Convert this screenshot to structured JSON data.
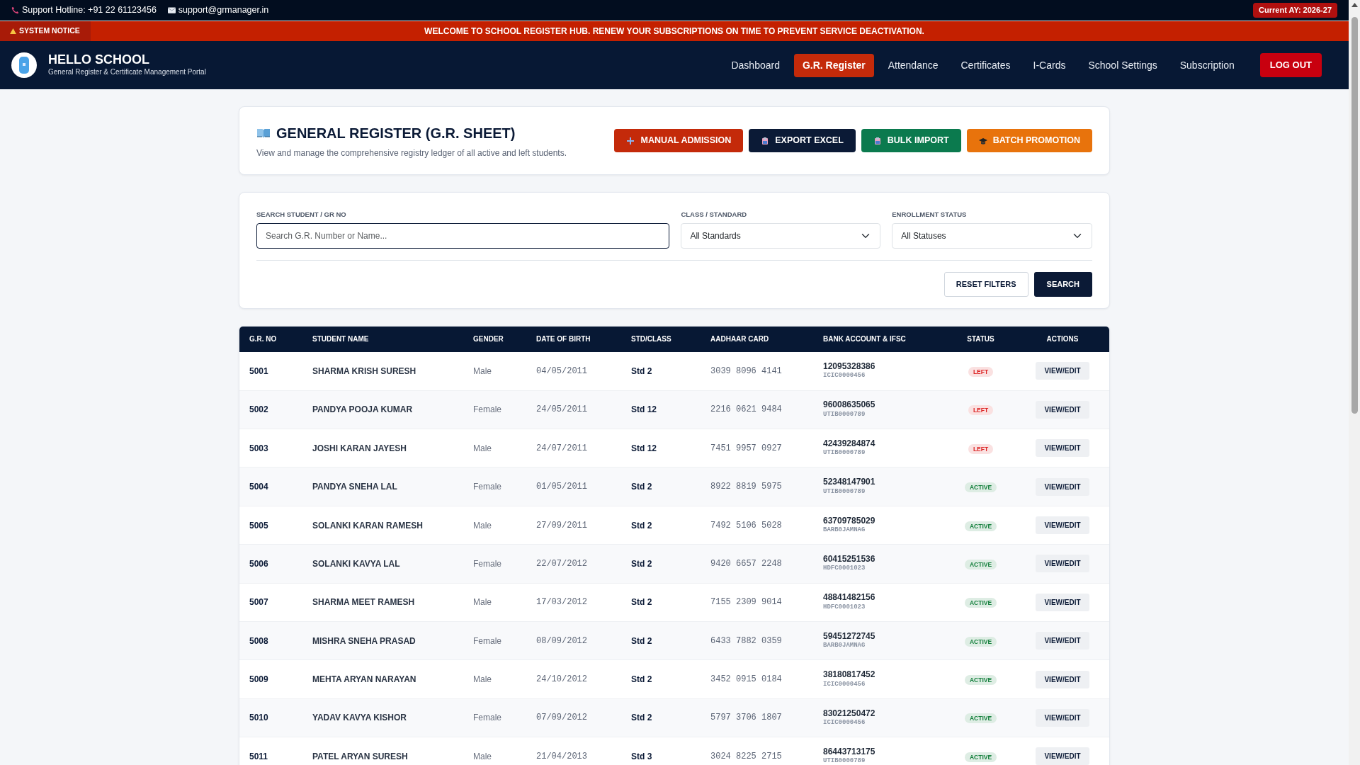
{
  "top_bar": {
    "hotline": "Support Hotline: +91 22 61123456",
    "email": "support@grmanager.in",
    "academic_year": "Current AY: 2026-27"
  },
  "notice": {
    "label": "SYSTEM NOTICE",
    "message": "WELCOME TO SCHOOL REGISTER HUB. RENEW YOUR SUBSCRIPTIONS ON TIME TO PREVENT SERVICE DEACTIVATION."
  },
  "header": {
    "title": "HELLO SCHOOL",
    "subtitle": "General Register & Certificate Management Portal",
    "nav": [
      {
        "label": "Dashboard",
        "selected": false
      },
      {
        "label": "G.R. Register",
        "selected": true
      },
      {
        "label": "Attendance",
        "selected": false
      },
      {
        "label": "Certificates",
        "selected": false
      },
      {
        "label": "I-Cards",
        "selected": false
      },
      {
        "label": "School Settings",
        "selected": false
      },
      {
        "label": "Subscription",
        "selected": false
      }
    ],
    "logout": "LOG OUT"
  },
  "page": {
    "title": "GENERAL REGISTER (G.R. SHEET)",
    "subtitle": "View and manage the comprehensive registry ledger of all active and left students.",
    "actions": [
      {
        "label": "MANUAL ADMISSION",
        "kind": "plus",
        "color": "#c42a0a"
      },
      {
        "label": "EXPORT EXCEL",
        "kind": "clipboard",
        "color": "#0b1a36"
      },
      {
        "label": "BULK IMPORT",
        "kind": "clipboard",
        "color": "#0b7a4e"
      },
      {
        "label": "BATCH PROMOTION",
        "kind": "cap",
        "color": "#e8730c"
      }
    ]
  },
  "filters": {
    "search": {
      "label": "SEARCH STUDENT / GR NO",
      "placeholder": "Search G.R. Number or Name..."
    },
    "standard": {
      "label": "CLASS / STANDARD",
      "value": "All Standards"
    },
    "status": {
      "label": "ENROLLMENT STATUS",
      "value": "All Statuses"
    },
    "reset": "RESET FILTERS",
    "submit": "SEARCH"
  },
  "table": {
    "columns": [
      "G.R. NO",
      "STUDENT NAME",
      "GENDER",
      "DATE OF BIRTH",
      "STD/CLASS",
      "AADHAAR CARD",
      "BANK ACCOUNT & IFSC",
      "STATUS",
      "ACTIONS"
    ],
    "rows": [
      {
        "gr_no": "5001",
        "name": "SHARMA KRISH SURESH",
        "gender": "Male",
        "dob": "04/05/2011",
        "std": "Std 2",
        "aadhaar": "3039 8096 4141",
        "bank_account": "12095328386",
        "ifsc": "ICIC0000456",
        "status": {
          "text": "LEFT",
          "color": "#dc2626"
        },
        "action": "VIEW/EDIT"
      },
      {
        "gr_no": "5002",
        "name": "PANDYA POOJA KUMAR",
        "gender": "Female",
        "dob": "24/05/2011",
        "std": "Std 12",
        "aadhaar": "2216 0621 9484",
        "bank_account": "96008635065",
        "ifsc": "UTIB0000789",
        "status": {
          "text": "LEFT",
          "color": "#dc2626"
        },
        "action": "VIEW/EDIT"
      },
      {
        "gr_no": "5003",
        "name": "JOSHI KARAN JAYESH",
        "gender": "Male",
        "dob": "24/07/2011",
        "std": "Std 12",
        "aadhaar": "7451 9957 0927",
        "bank_account": "42439284874",
        "ifsc": "UTIB0000789",
        "status": {
          "text": "LEFT",
          "color": "#dc2626"
        },
        "action": "VIEW/EDIT"
      },
      {
        "gr_no": "5004",
        "name": "PANDYA SNEHA LAL",
        "gender": "Female",
        "dob": "01/05/2011",
        "std": "Std 2",
        "aadhaar": "8922 8819 5975",
        "bank_account": "52348147901",
        "ifsc": "UTIB0000789",
        "status": {
          "text": "ACTIVE",
          "color": "#15803d"
        },
        "action": "VIEW/EDIT"
      },
      {
        "gr_no": "5005",
        "name": "SOLANKI KARAN RAMESH",
        "gender": "Male",
        "dob": "27/09/2011",
        "std": "Std 2",
        "aadhaar": "7492 5106 5028",
        "bank_account": "63709785029",
        "ifsc": "BARB0JAMNAG",
        "status": {
          "text": "ACTIVE",
          "color": "#15803d"
        },
        "action": "VIEW/EDIT"
      },
      {
        "gr_no": "5006",
        "name": "SOLANKI KAVYA LAL",
        "gender": "Female",
        "dob": "22/07/2012",
        "std": "Std 2",
        "aadhaar": "9420 6657 2248",
        "bank_account": "60415251536",
        "ifsc": "HDFC0001023",
        "status": {
          "text": "ACTIVE",
          "color": "#15803d"
        },
        "action": "VIEW/EDIT"
      },
      {
        "gr_no": "5007",
        "name": "SHARMA MEET RAMESH",
        "gender": "Male",
        "dob": "17/03/2012",
        "std": "Std 2",
        "aadhaar": "7155 2309 9014",
        "bank_account": "48841482156",
        "ifsc": "HDFC0001023",
        "status": {
          "text": "ACTIVE",
          "color": "#15803d"
        },
        "action": "VIEW/EDIT"
      },
      {
        "gr_no": "5008",
        "name": "MISHRA SNEHA PRASAD",
        "gender": "Female",
        "dob": "08/09/2012",
        "std": "Std 2",
        "aadhaar": "6433 7882 0359",
        "bank_account": "59451272745",
        "ifsc": "BARB0JAMNAG",
        "status": {
          "text": "ACTIVE",
          "color": "#15803d"
        },
        "action": "VIEW/EDIT"
      },
      {
        "gr_no": "5009",
        "name": "MEHTA ARYAN NARAYAN",
        "gender": "Male",
        "dob": "24/10/2012",
        "std": "Std 2",
        "aadhaar": "3452 0915 0184",
        "bank_account": "38180817452",
        "ifsc": "ICIC0000456",
        "status": {
          "text": "ACTIVE",
          "color": "#15803d"
        },
        "action": "VIEW/EDIT"
      },
      {
        "gr_no": "5010",
        "name": "YADAV KAVYA KISHOR",
        "gender": "Female",
        "dob": "07/09/2012",
        "std": "Std 2",
        "aadhaar": "5797 3706 1807",
        "bank_account": "83021250472",
        "ifsc": "ICIC0000456",
        "status": {
          "text": "ACTIVE",
          "color": "#15803d"
        },
        "action": "VIEW/EDIT"
      },
      {
        "gr_no": "5011",
        "name": "PATEL ARYAN SURESH",
        "gender": "Male",
        "dob": "21/04/2013",
        "std": "Std 3",
        "aadhaar": "3024 8225 2715",
        "bank_account": "86443713175",
        "ifsc": "UTIB0000789",
        "status": {
          "text": "ACTIVE",
          "color": "#15803d"
        },
        "action": "VIEW/EDIT"
      }
    ]
  }
}
